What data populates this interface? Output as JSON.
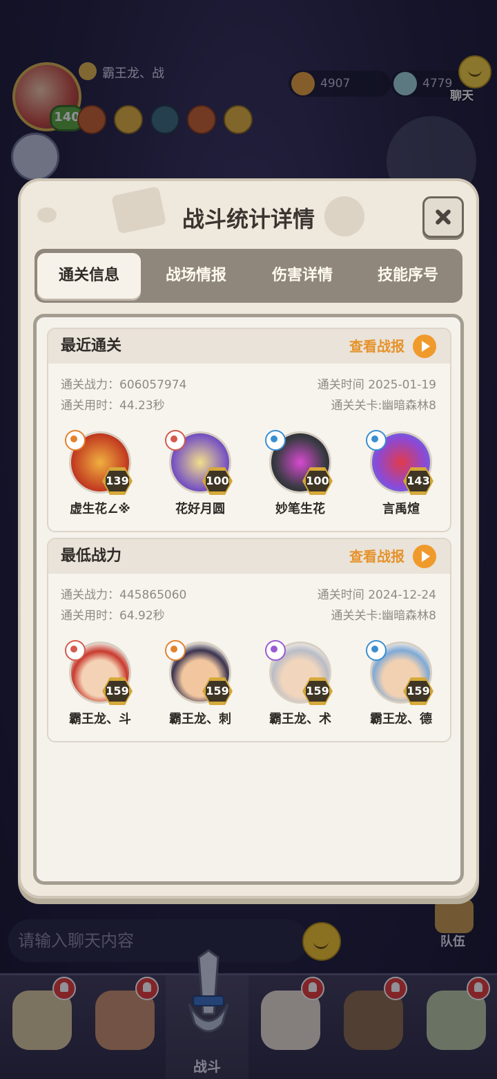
{
  "hud": {
    "player_name": "霸王龙、战",
    "player_level": "140",
    "currency_gold": "4907",
    "currency_gem": "4779",
    "chat_label": "聊天"
  },
  "chat_input_placeholder": "请输入聊天内容",
  "team_label": "队伍",
  "bottom_nav": {
    "battle_label": "战斗"
  },
  "modal": {
    "title": "战斗统计详情",
    "tabs": [
      "通关信息",
      "战场情报",
      "伤害详情",
      "技能序号"
    ],
    "active_tab": 0,
    "sections": [
      {
        "title": "最近通关",
        "view_report": "查看战报",
        "power_label": "通关战力：606057974",
        "time_label": "通关用时：44.23秒",
        "date_label": "通关时间  2025-01-19",
        "stage_label": "通关关卡:幽暗森林8",
        "heroes": [
          {
            "name": "虚生花∠※",
            "level": "139",
            "element": "orange"
          },
          {
            "name": "花好月圆",
            "level": "100",
            "element": "red"
          },
          {
            "name": "妙笔生花",
            "level": "100",
            "element": "blue"
          },
          {
            "name": "言禹煊",
            "level": "143",
            "element": "blue"
          }
        ]
      },
      {
        "title": "最低战力",
        "view_report": "查看战报",
        "power_label": "通关战力：445865060",
        "time_label": "通关用时：64.92秒",
        "date_label": "通关时间  2024-12-24",
        "stage_label": "通关关卡:幽暗森林8",
        "heroes": [
          {
            "name": "霸王龙、斗",
            "level": "159",
            "element": "red"
          },
          {
            "name": "霸王龙、刺",
            "level": "159",
            "element": "orange"
          },
          {
            "name": "霸王龙、术",
            "level": "159",
            "element": "purple"
          },
          {
            "name": "霸王龙、德",
            "level": "159",
            "element": "blue"
          }
        ]
      }
    ]
  },
  "colors": {
    "accent_orange": "#e6922b",
    "panel_bg": "#f5f2ec",
    "tab_bar": "#8f877c"
  }
}
